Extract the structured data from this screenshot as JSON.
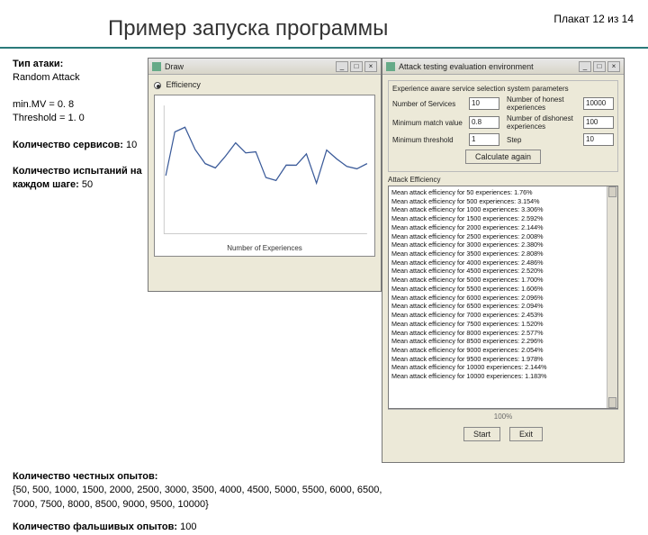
{
  "header": {
    "title": "Пример запуска программы",
    "poster": "Плакат 12 из 14"
  },
  "left": {
    "attack_type_label": "Тип атаки:",
    "attack_type_value": "Random Attack",
    "minmv": "min.MV = 0. 8",
    "threshold": "Threshold = 1. 0",
    "services_label": "Количество сервисов:",
    "services_value": " 10",
    "trials_label": "Количество испытаний на каждом шаге:",
    "trials_value": " 50"
  },
  "below": {
    "honest_label": "Количество честных опытов:",
    "honest_list": "{50, 500, 1000, 1500, 2000, 2500, 3000, 3500, 4000, 4500, 5000, 5500, 6000, 6500, 7000, 7500, 8000, 8500, 9000, 9500, 10000}",
    "fake_label": "Количество фальшивых опытов:",
    "fake_value": " 100"
  },
  "win1": {
    "title": "Draw",
    "radio": "Efficiency",
    "xlabel": "Number of Experiences"
  },
  "win2": {
    "title": "Attack testing evaluation environment",
    "section": "Experience aware service selection system parameters",
    "f_services": "Number of Services",
    "f_services_v": "10",
    "f_honest": "Number of honest experiences",
    "f_honest_v": "10000",
    "f_minmv": "Minimum match value",
    "f_minmv_v": "0.8",
    "f_dishonest": "Number of dishonest experiences",
    "f_dishonest_v": "100",
    "f_thresh": "Minimum threshold",
    "f_thresh_v": "1",
    "f_step": "Step",
    "f_step_v": "10",
    "btn_calc": "Calculate again",
    "eff_title": "Attack Efficiency",
    "status": "100%",
    "btn_start": "Start",
    "btn_exit": "Exit"
  },
  "log_lines": [
    "Mean attack efficiency for 50 experiences: 1.76%",
    "Mean attack efficiency for 500 experiences: 3.154%",
    "Mean attack efficiency for 1000 experiences: 3.306%",
    "Mean attack efficiency for 1500 experiences: 2.592%",
    "Mean attack efficiency for 2000 experiences: 2.144%",
    "Mean attack efficiency for 2500 experiences: 2.008%",
    "Mean attack efficiency for 3000 experiences: 2.380%",
    "Mean attack efficiency for 3500 experiences: 2.808%",
    "Mean attack efficiency for 4000 experiences: 2.486%",
    "Mean attack efficiency for 4500 experiences: 2.520%",
    "Mean attack efficiency for 5000 experiences: 1.700%",
    "Mean attack efficiency for 5500 experiences: 1.606%",
    "Mean attack efficiency for 6000 experiences: 2.096%",
    "Mean attack efficiency for 6500 experiences: 2.094%",
    "Mean attack efficiency for 7000 experiences: 2.453%",
    "Mean attack efficiency for 7500 experiences: 1.520%",
    "Mean attack efficiency for 8000 experiences: 2.577%",
    "Mean attack efficiency for 8500 experiences: 2.296%",
    "Mean attack efficiency for 9000 experiences: 2.054%",
    "Mean attack efficiency for 9500 experiences: 1.978%",
    "Mean attack efficiency for 10000 experiences: 2.144%",
    "Mean attack efficiency for 10000 experiences: 1.183%"
  ],
  "chart_data": {
    "type": "line",
    "title": "",
    "xlabel": "Number of Experiences",
    "ylabel": "",
    "x": [
      50,
      500,
      1000,
      1500,
      2000,
      2500,
      3000,
      3500,
      4000,
      4500,
      5000,
      5500,
      6000,
      6500,
      7000,
      7500,
      8000,
      8500,
      9000,
      9500,
      10000
    ],
    "values": [
      1.76,
      3.154,
      3.306,
      2.592,
      2.144,
      2.008,
      2.38,
      2.808,
      2.486,
      2.52,
      1.7,
      1.606,
      2.096,
      2.094,
      2.453,
      1.52,
      2.577,
      2.296,
      2.054,
      1.978,
      2.144
    ],
    "ylim": [
      0,
      4
    ]
  }
}
